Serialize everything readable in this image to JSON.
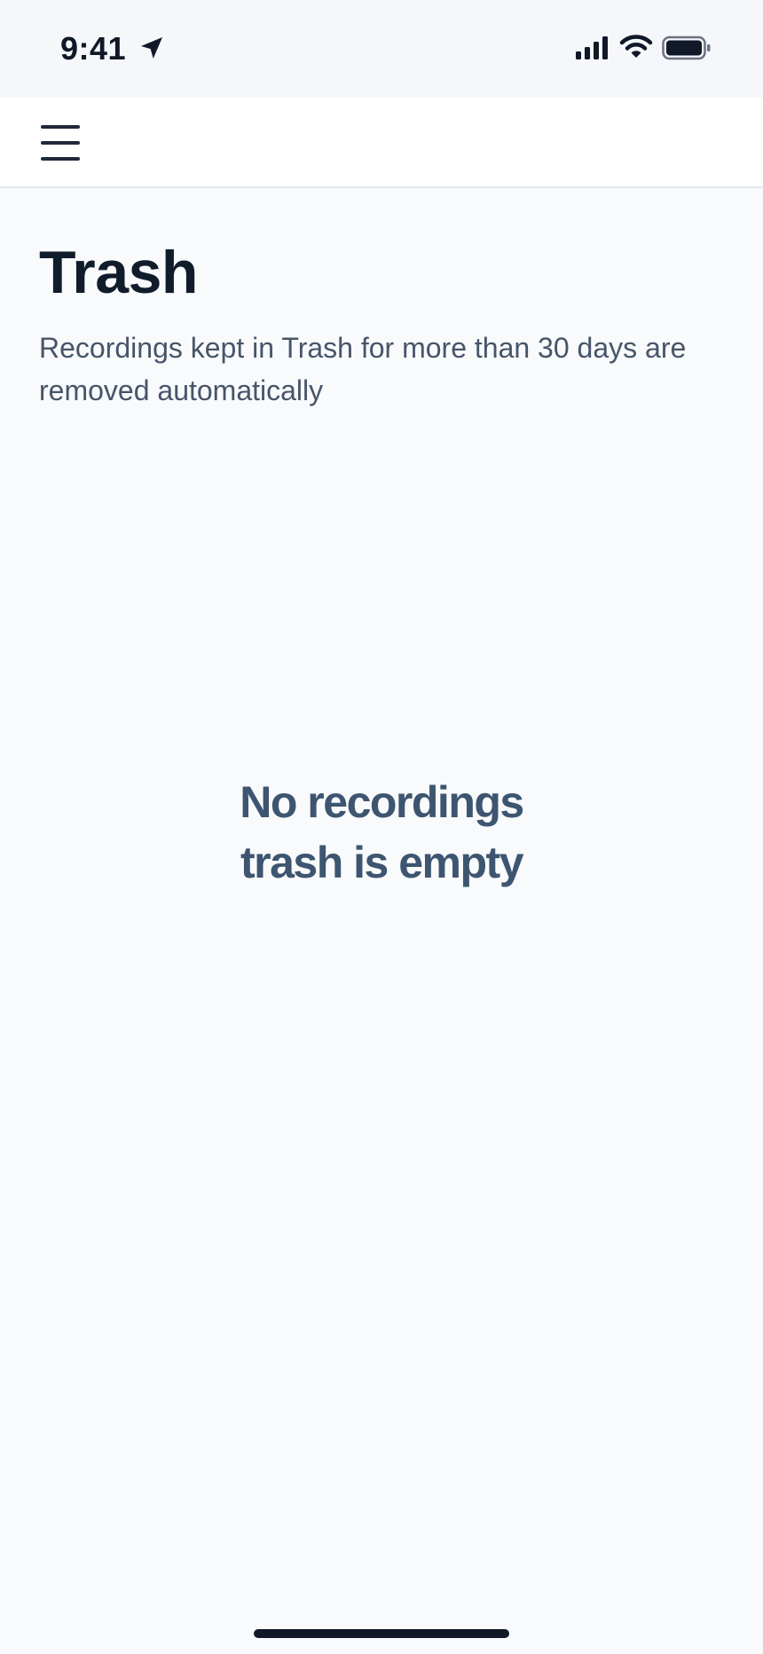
{
  "status_bar": {
    "time": "9:41",
    "icons": [
      "location-arrow-icon",
      "cellular-signal-icon",
      "wifi-icon",
      "battery-icon"
    ]
  },
  "header": {
    "menu_icon": "hamburger-menu-icon"
  },
  "page": {
    "title": "Trash",
    "subtitle": "Recordings kept in Trash for more than 30 days are removed automatically"
  },
  "empty_state": {
    "line1": "No recordings",
    "line2": "trash is empty"
  },
  "colors": {
    "background": "#f8fafc",
    "header_bg": "#ffffff",
    "title": "#111c2b",
    "subtitle": "#475569",
    "empty_text": "#3d5570"
  }
}
